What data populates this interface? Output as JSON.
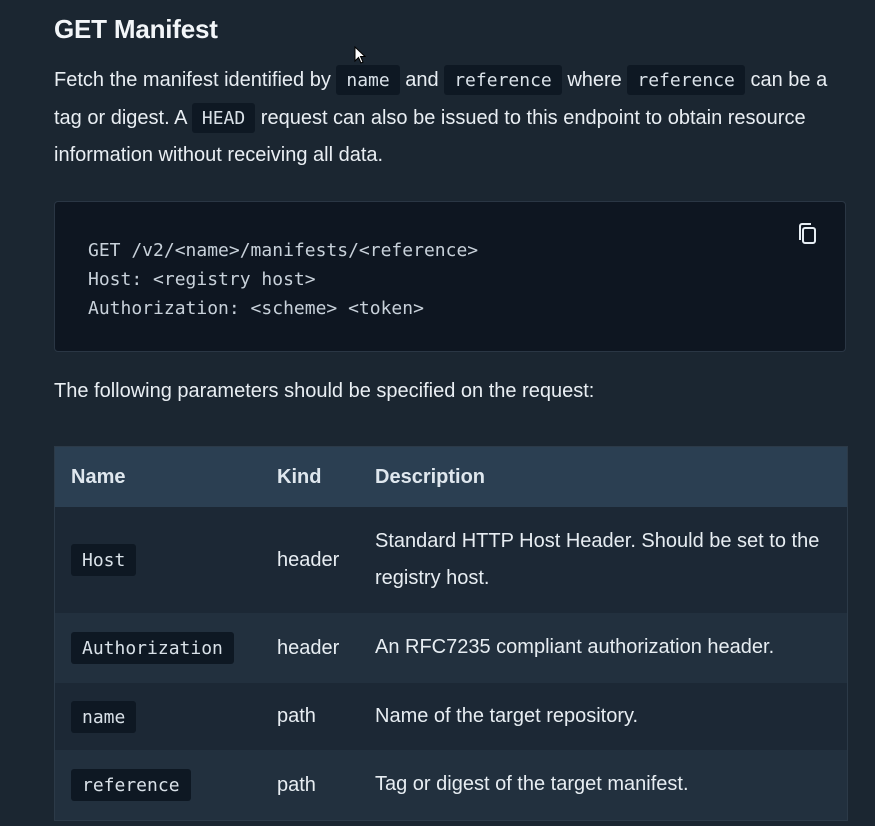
{
  "section": {
    "title": "GET Manifest"
  },
  "intro": {
    "p1": "Fetch the manifest identified by ",
    "code_name": "name",
    "p2": " and ",
    "code_reference1": "reference",
    "p3": " where ",
    "code_reference2": "reference",
    "p4": " can be a tag or digest. A ",
    "code_head": "HEAD",
    "p5": " request can also be issued to this endpoint to obtain resource information without receiving all data."
  },
  "code_block": {
    "text": "GET /v2/<name>/manifests/<reference>\nHost: <registry host>\nAuthorization: <scheme> <token>",
    "copy_icon": "copy-icon"
  },
  "params_lead": "The following parameters should be specified on the request:",
  "table": {
    "headers": [
      "Name",
      "Kind",
      "Description"
    ],
    "rows": [
      {
        "name": "Host",
        "kind": "header",
        "description": "Standard HTTP Host Header. Should be set to the registry host."
      },
      {
        "name": "Authorization",
        "kind": "header",
        "description": "An RFC7235 compliant authorization header."
      },
      {
        "name": "name",
        "kind": "path",
        "description": "Name of the target repository."
      },
      {
        "name": "reference",
        "kind": "path",
        "description": "Tag or digest of the target manifest."
      }
    ]
  },
  "colors": {
    "background": "#1b2631",
    "code_bg": "#0e1621",
    "table_header_bg": "#2b3f52"
  }
}
